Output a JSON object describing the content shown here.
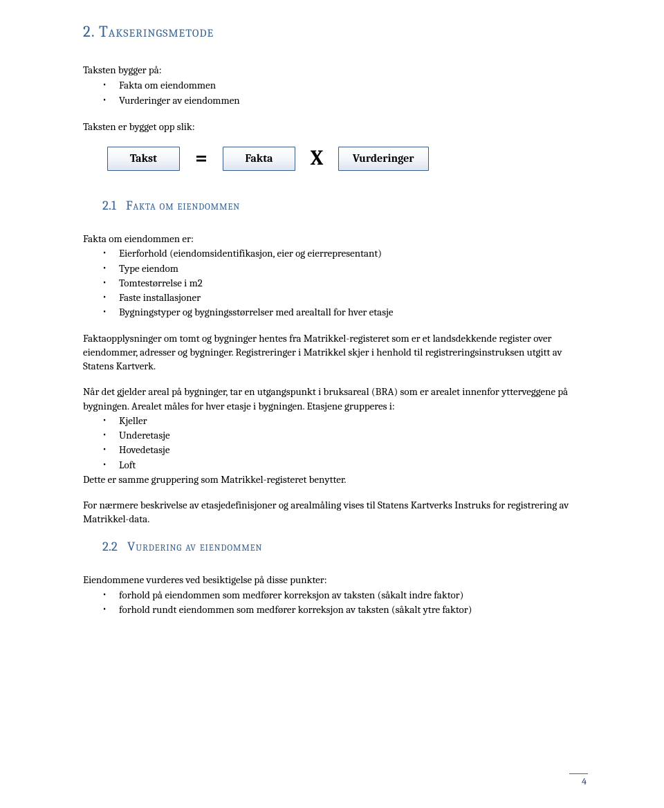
{
  "heading_main": {
    "num": "2.",
    "text": "Takseringsmetode"
  },
  "intro": "Taksten bygger på:",
  "intro_bullets": [
    "Fakta om eiendommen",
    "Vurderinger av eiendommen"
  ],
  "built_line": "Taksten er bygget opp slik:",
  "formula": {
    "box1": "Takst",
    "op1": "=",
    "box2": "Fakta",
    "op2": "X",
    "box3": "Vurderinger"
  },
  "heading_21": {
    "num": "2.1",
    "text": "Fakta om eiendommen"
  },
  "fakta_intro": "Fakta om eiendommen er:",
  "fakta_bullets": [
    "Eierforhold (eiendomsidentifikasjon, eier og eierrepresentant)",
    "Type eiendom",
    "Tomtestørrelse i m2",
    "Faste installasjoner",
    "Bygningstyper og bygningsstørrelser med arealtall for hver etasje"
  ],
  "fakta_para": "Faktaopplysninger om tomt og bygninger hentes fra Matrikkel-registeret som er et landsdekkende register over eiendommer, adresser og bygninger. Registreringer i Matrikkel skjer i henhold til registreringsinstruksen utgitt av Statens Kartverk.",
  "areal_para": "Når det gjelder areal på bygninger, tar en utgangspunkt i bruksareal (BRA) som er arealet innenfor ytterveggene på bygningen. Arealet måles for hver etasje i bygningen. Etasjene grupperes i:",
  "etasje_bullets": [
    "Kjeller",
    "Underetasje",
    "Hovedetasje",
    "Loft"
  ],
  "gruppering_line": "Dette er samme gruppering som Matrikkel-registeret benytter.",
  "ref_para": "For nærmere beskrivelse av etasjedefinisjoner og arealmåling vises til Statens Kartverks Instruks for registrering av Matrikkel-data.",
  "heading_22": {
    "num": "2.2",
    "text": "Vurdering av eiendommen"
  },
  "vurdering_intro": "Eiendommene vurderes ved besiktigelse på disse punkter:",
  "vurdering_bullets": [
    "forhold på eiendommen som medfører korreksjon av taksten (såkalt indre faktor)",
    "forhold rundt eiendommen som medfører korreksjon av taksten (såkalt ytre faktor)"
  ],
  "page_number": "4"
}
